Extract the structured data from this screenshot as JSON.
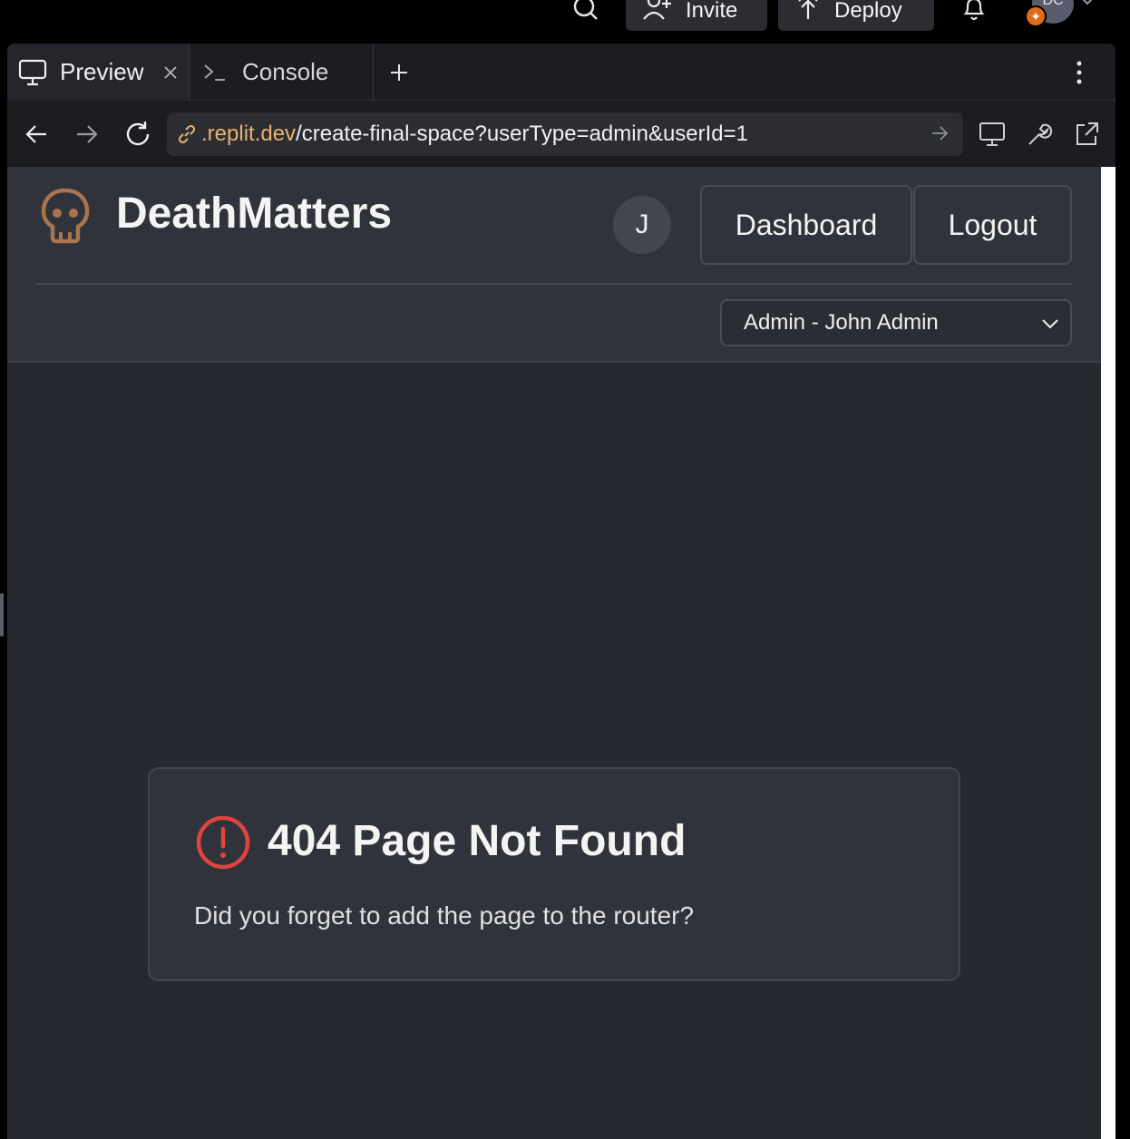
{
  "topbar": {
    "invite_label": "Invite",
    "deploy_label": "Deploy",
    "avatar_initials": "DC"
  },
  "tabs": [
    {
      "label": "Preview",
      "icon": "monitor-icon",
      "active": true
    },
    {
      "label": "Console",
      "icon": "terminal-icon",
      "active": false
    }
  ],
  "url": {
    "host": ".replit.dev",
    "path": "/create-final-space?userType=admin&userId=1"
  },
  "app": {
    "title": "DeathMatters",
    "logo_icon": "skull-icon",
    "user_initial": "J",
    "dashboard_label": "Dashboard",
    "logout_label": "Logout",
    "user_select_value": "Admin - John Admin"
  },
  "error_card": {
    "title": "404 Page Not Found",
    "message": "Did you forget to add the page to the router?",
    "icon": "alert-circle-icon"
  },
  "colors": {
    "accent_orange": "#e9b36b",
    "error_red": "#e0443e",
    "skull": "#a9754d"
  }
}
